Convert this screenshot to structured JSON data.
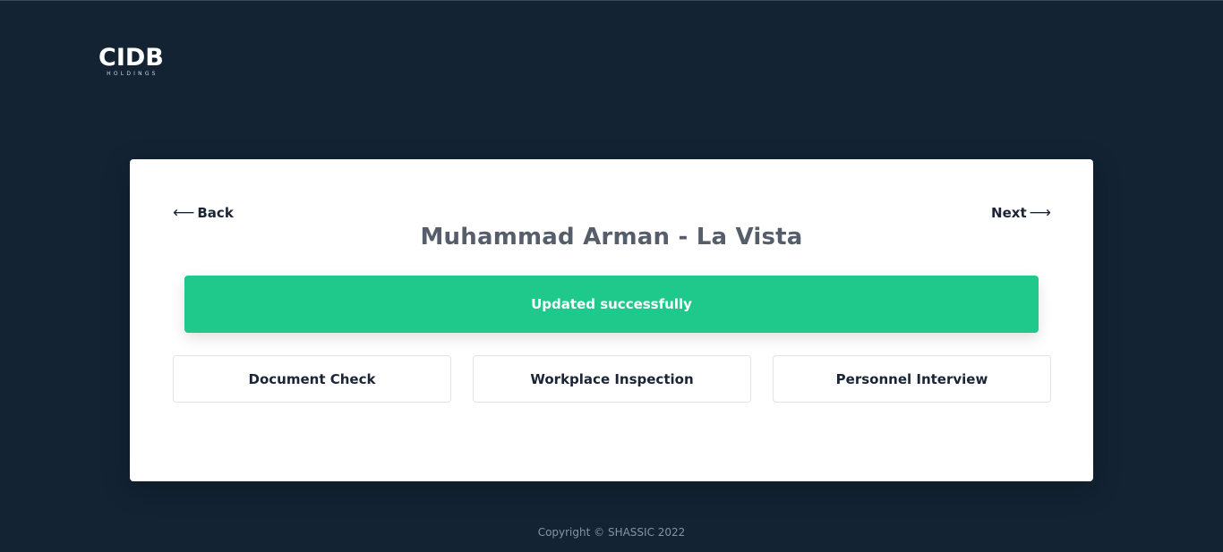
{
  "logo": {
    "main": "CIDB",
    "sub": "HOLDINGS"
  },
  "nav": {
    "back_label": "Back",
    "back_arrow": "⟵",
    "next_label": "Next",
    "next_arrow": "⟶"
  },
  "title": "Muhammad Arman - La Vista",
  "alert": {
    "message": "Updated successfully",
    "color": "#1fc98b"
  },
  "options": [
    {
      "label": "Document Check"
    },
    {
      "label": "Workplace Inspection"
    },
    {
      "label": "Personnel Interview"
    }
  ],
  "footer": {
    "copyright": "Copyright © SHASSIC 2022"
  },
  "colors": {
    "background": "#132333",
    "card": "#ffffff",
    "accent": "#1fc98b"
  }
}
